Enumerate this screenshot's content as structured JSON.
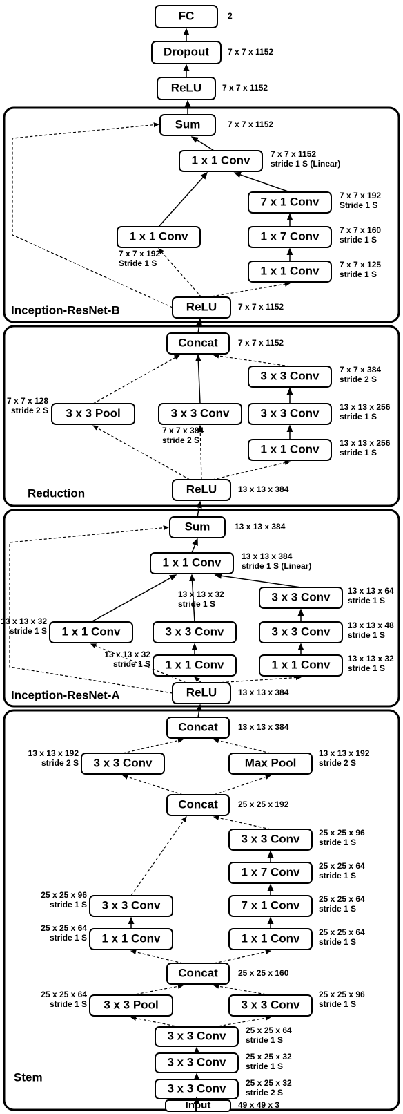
{
  "head": {
    "fc": "FC",
    "fc_ann": "2",
    "dropout": "Dropout",
    "dropout_ann": "7 x  7 x 1152",
    "relu": "ReLU",
    "relu_ann": "7 x 7 x 1152"
  },
  "irb": {
    "title": "Inception-ResNet-B",
    "sum": "Sum",
    "sum_ann": "7 x 7 x 1152",
    "conv11_top": "1 x 1 Conv",
    "conv11_top_ann1": "7 x 7 x 1152",
    "conv11_top_ann2": "stride 1 S (Linear)",
    "conv71": "7 x 1 Conv",
    "conv71_ann1": "7 x 7 x 192",
    "conv71_ann2": "Stride 1 S",
    "conv11_left": "1 x 1 Conv",
    "conv11_left_ann1": "7 x 7 x 192",
    "conv11_left_ann2": "Stride 1 S",
    "conv17": "1 x 7 Conv",
    "conv17_ann1": "7 x 7 x 160",
    "conv17_ann2": "stride 1 S",
    "conv11_r": "1 x 1 Conv",
    "conv11_r_ann1": "7 x 7 x 125",
    "conv11_r_ann2": "stride 1 S",
    "relu": "ReLU",
    "relu_ann": "7 x 7 x 1152"
  },
  "red": {
    "title": "Reduction",
    "concat": "Concat",
    "concat_ann": "7 x 7 x 1152",
    "conv33_r_top": "3 x 3 Conv",
    "conv33_r_top_ann1": "7 x 7 x 384",
    "conv33_r_top_ann2": "stride 2 S",
    "pool": "3 x 3 Pool",
    "pool_ann1": "7 x 7 x 128",
    "pool_ann2": "stride 2 S",
    "conv33_mid": "3 x 3 Conv",
    "conv33_mid_ann1": "7 x 7 x 384",
    "conv33_mid_ann2": "stride 2 S",
    "conv33_r_mid": "3 x 3 Conv",
    "conv33_r_mid_ann1": "13 x 13 x 256",
    "conv33_r_mid_ann2": "stride 1 S",
    "conv11_r": "1 x 1 Conv",
    "conv11_r_ann1": "13 x 13 x 256",
    "conv11_r_ann2": "stride 1 S",
    "relu": "ReLU",
    "relu_ann": "13 x  13 x 384"
  },
  "ira": {
    "title": "Inception-ResNet-A",
    "sum": "Sum",
    "sum_ann": "13 x  13 x 384",
    "conv11_top": "1 x 1 Conv",
    "conv11_top_ann1": "13 x 13 x 384",
    "conv11_top_ann2": "stride 1 S (Linear)",
    "conv33_r_top": "3 x 3 Conv",
    "conv33_r_top_ann1": "13 x 13 x 64",
    "conv33_r_top_ann2": "stride 1 S",
    "conv11_l": "1 x 1 Conv",
    "conv11_l_ann1": "13 x 13 x 32",
    "conv11_l_ann2": "stride 1 S",
    "conv33_m": "3 x 3 Conv",
    "conv33_m_ann1": "13 x 13 x 32",
    "conv33_m_ann2": "stride 1 S",
    "conv33_r": "3 x 3 Conv",
    "conv33_r_ann1": "13 x 13 x 48",
    "conv33_r_ann2": "stride 1 S",
    "conv11_m": "1 x 1 Conv",
    "conv11_m_ann1": "13 x 13 x 32",
    "conv11_m_ann2": "stride 1 S",
    "conv11_r": "1 x 1 Conv",
    "conv11_r_ann1": "13 x 13 x 32",
    "conv11_r_ann2": "stride 1 S",
    "relu": "ReLU",
    "relu_ann": "13 x 13 x 384"
  },
  "stem": {
    "title": "Stem",
    "concat_top": "Concat",
    "concat_top_ann": "13 x 13 x 384",
    "conv33_l": "3 x 3 Conv",
    "conv33_l_ann1": "13 x 13 x 192",
    "conv33_l_ann2": "stride 2 S",
    "maxpool": "Max Pool",
    "maxpool_ann1": "13 x 13 x 192",
    "maxpool_ann2": "stride 2 S",
    "concat_mid": "Concat",
    "concat_mid_ann": "25 x 25 x 192",
    "conv33_r_top": "3 x 3 Conv",
    "conv33_r_top_ann1": "25 x 25 x 96",
    "conv33_r_top_ann2": "stride 1 S",
    "conv17": "1 x 7 Conv",
    "conv17_ann1": "25 x 25 x 64",
    "conv17_ann2": "stride 1 S",
    "conv33_l2": "3 x 3 Conv",
    "conv33_l2_ann1": "25 x 25 x 96",
    "conv33_l2_ann2": "stride 1 S",
    "conv71": "7 x 1 Conv",
    "conv71_ann1": "25 x 25 x 64",
    "conv71_ann2": "stride 1 S",
    "conv11_l": "1 x 1 Conv",
    "conv11_l_ann1": "25 x 25 x 64",
    "conv11_l_ann2": "stride 1 S",
    "conv11_r": "1 x 1 Conv",
    "conv11_r_ann1": "25 x 25 x 64",
    "conv11_r_ann2": "stride 1 S",
    "concat_low": "Concat",
    "concat_low_ann": "25 x 25 x 160",
    "pool33": "3 x 3 Pool",
    "pool33_ann1": "25 x 25 x 64",
    "pool33_ann2": "stride 1 S",
    "conv33_low": "3 x 3 Conv",
    "conv33_low_ann1": "25 x 25 x 96",
    "conv33_low_ann2": "stride 1 S",
    "conv33a": "3 x 3 Conv",
    "conv33a_ann1": "25 x 25 x 64",
    "conv33a_ann2": "stride 1 S",
    "conv33b": "3 x 3 Conv",
    "conv33b_ann1": "25 x 25 x 32",
    "conv33b_ann2": "stride 1 S",
    "conv33c": "3 x 3 Conv",
    "conv33c_ann1": "25 x 25 x 32",
    "conv33c_ann2": "stride 2 S",
    "input": "Input",
    "input_ann": "49 x 49 x 3"
  }
}
